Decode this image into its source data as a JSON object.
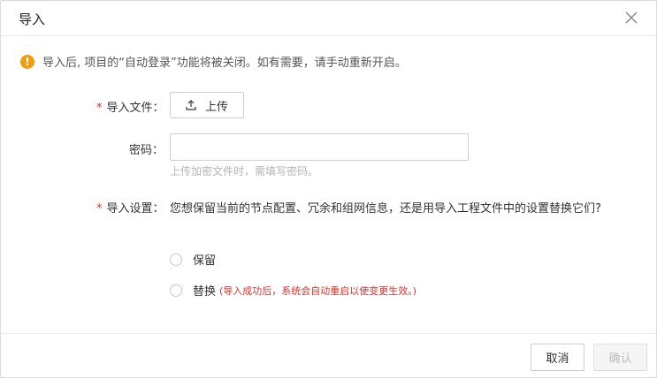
{
  "dialog": {
    "title": "导入",
    "close_icon": "close-icon"
  },
  "warning": {
    "icon": "warning-icon",
    "icon_glyph": "!",
    "text": "导入后, 项目的“自动登录”功能将被关闭。如有需要，请手动重新开启。",
    "color": "#f39c12"
  },
  "form": {
    "file_label": "导入文件：",
    "upload_label": "上传",
    "password_label": "密码：",
    "password_value": "",
    "password_hint": "上传加密文件时，需填写密码。",
    "settings_label": "导入设置：",
    "settings_question": "您想保留当前的节点配置、冗余和组网信息，还是用导入工程文件中的设置替换它们?",
    "required_mark": "*",
    "options": [
      {
        "label": "保留",
        "note": ""
      },
      {
        "label": "替换",
        "note": "(导入成功后，系统会自动重启以使变更生效。)"
      }
    ]
  },
  "footer": {
    "cancel_label": "取消",
    "confirm_label": "确认"
  }
}
